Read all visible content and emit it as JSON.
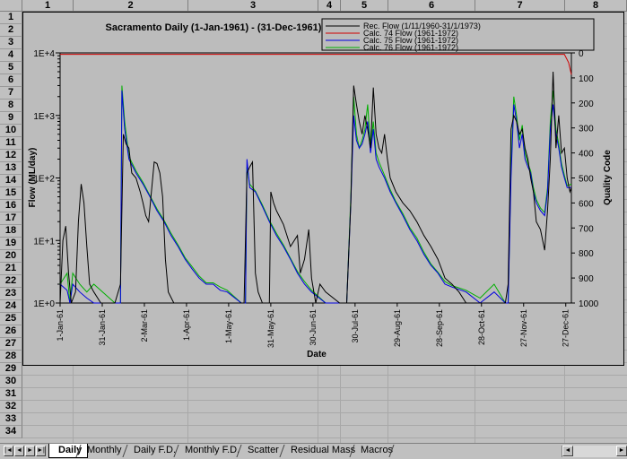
{
  "columns": [
    "1",
    "2",
    "3",
    "4",
    "5",
    "6",
    "7",
    "8"
  ],
  "rows": [
    "1",
    "2",
    "3",
    "4",
    "5",
    "6",
    "7",
    "8",
    "9",
    "10",
    "11",
    "12",
    "13",
    "14",
    "15",
    "16",
    "17",
    "18",
    "19",
    "20",
    "21",
    "22",
    "23",
    "24",
    "25",
    "26",
    "27",
    "28",
    "29",
    "30",
    "31",
    "32",
    "33",
    "34"
  ],
  "tabs": [
    {
      "label": "Daily",
      "active": true
    },
    {
      "label": "Monthly",
      "active": false
    },
    {
      "label": "Daily F.D.",
      "active": false
    },
    {
      "label": "Monthly F.D.",
      "active": false
    },
    {
      "label": "Scatter",
      "active": false
    },
    {
      "label": "Residual Mass",
      "active": false
    },
    {
      "label": "Macros",
      "active": false
    }
  ],
  "nav_icons": [
    "first-sheet-icon",
    "prev-sheet-icon",
    "next-sheet-icon",
    "last-sheet-icon"
  ],
  "colors": {
    "rec": "#000000",
    "c74": "#d00000",
    "c75": "#0000e0",
    "c76": "#00b000",
    "magenta": "#e000e0"
  },
  "chart_data": {
    "type": "line",
    "title": "Sacramento Daily (1-Jan-1961) - (31-Dec-1961)",
    "xlabel": "Date",
    "ylabel": "Flow (ML/day)",
    "y2label": "Quality Code",
    "yscale": "log",
    "ylim": [
      1,
      10000
    ],
    "y_ticks": [
      "1E+0",
      "1E+1",
      "1E+2",
      "1E+3",
      "1E+4"
    ],
    "y2lim": [
      0,
      1000
    ],
    "y2_inverted": true,
    "y2_ticks": [
      "0",
      "100",
      "200",
      "300",
      "400",
      "500",
      "600",
      "700",
      "800",
      "900",
      "1000"
    ],
    "x_ticks": [
      "1-Jan-61",
      "31-Jan-61",
      "2-Mar-61",
      "1-Apr-61",
      "1-May-61",
      "31-May-61",
      "30-Jun-61",
      "30-Jul-61",
      "29-Aug-61",
      "28-Sep-61",
      "28-Oct-61",
      "27-Nov-61",
      "27-Dec-61"
    ],
    "legend_position": "top-right",
    "series": [
      {
        "name": "Rec. Flow (1/11/1960-31/1/1973)",
        "color": "#000000",
        "points": [
          [
            1,
            1
          ],
          [
            3,
            10
          ],
          [
            5,
            17
          ],
          [
            7,
            3
          ],
          [
            9,
            1
          ],
          [
            12,
            1.5
          ],
          [
            14,
            20
          ],
          [
            16,
            80
          ],
          [
            18,
            40
          ],
          [
            20,
            8
          ],
          [
            22,
            2
          ],
          [
            25,
            1.5
          ],
          [
            30,
            1
          ],
          [
            35,
            1
          ],
          [
            40,
            1
          ],
          [
            44,
            2
          ],
          [
            46,
            500
          ],
          [
            48,
            350
          ],
          [
            50,
            300
          ],
          [
            52,
            120
          ],
          [
            55,
            100
          ],
          [
            58,
            60
          ],
          [
            60,
            40
          ],
          [
            62,
            25
          ],
          [
            64,
            20
          ],
          [
            66,
            60
          ],
          [
            68,
            180
          ],
          [
            70,
            170
          ],
          [
            72,
            120
          ],
          [
            74,
            50
          ],
          [
            76,
            5
          ],
          [
            78,
            1.5
          ],
          [
            82,
            1
          ],
          [
            90,
            1
          ],
          [
            100,
            1
          ],
          [
            110,
            1
          ],
          [
            120,
            1
          ],
          [
            125,
            1
          ],
          [
            130,
            1
          ],
          [
            132,
            1
          ],
          [
            134,
            120
          ],
          [
            136,
            150
          ],
          [
            138,
            180
          ],
          [
            140,
            3
          ],
          [
            142,
            1.5
          ],
          [
            145,
            1
          ],
          [
            150,
            1
          ],
          [
            151,
            60
          ],
          [
            153,
            40
          ],
          [
            155,
            30
          ],
          [
            160,
            18
          ],
          [
            165,
            8
          ],
          [
            170,
            12
          ],
          [
            172,
            3
          ],
          [
            175,
            5
          ],
          [
            178,
            15
          ],
          [
            180,
            2.5
          ],
          [
            183,
            1
          ],
          [
            186,
            2
          ],
          [
            190,
            1.5
          ],
          [
            200,
            1
          ],
          [
            205,
            1
          ],
          [
            208,
            40
          ],
          [
            210,
            3000
          ],
          [
            212,
            1500
          ],
          [
            214,
            800
          ],
          [
            216,
            500
          ],
          [
            218,
            1000
          ],
          [
            220,
            600
          ],
          [
            222,
            300
          ],
          [
            224,
            2800
          ],
          [
            226,
            500
          ],
          [
            228,
            300
          ],
          [
            230,
            250
          ],
          [
            232,
            500
          ],
          [
            234,
            200
          ],
          [
            236,
            100
          ],
          [
            240,
            60
          ],
          [
            245,
            40
          ],
          [
            250,
            30
          ],
          [
            255,
            20
          ],
          [
            260,
            12
          ],
          [
            265,
            8
          ],
          [
            270,
            5
          ],
          [
            275,
            2.5
          ],
          [
            280,
            2
          ],
          [
            285,
            1.5
          ],
          [
            290,
            1
          ],
          [
            300,
            1
          ],
          [
            310,
            1
          ],
          [
            315,
            1
          ],
          [
            318,
            1
          ],
          [
            320,
            2
          ],
          [
            322,
            600
          ],
          [
            324,
            1000
          ],
          [
            326,
            800
          ],
          [
            328,
            500
          ],
          [
            330,
            600
          ],
          [
            332,
            300
          ],
          [
            334,
            200
          ],
          [
            336,
            100
          ],
          [
            338,
            60
          ],
          [
            340,
            20
          ],
          [
            343,
            15
          ],
          [
            346,
            7
          ],
          [
            348,
            30
          ],
          [
            350,
            200
          ],
          [
            352,
            5000
          ],
          [
            354,
            300
          ],
          [
            356,
            1000
          ],
          [
            358,
            250
          ],
          [
            360,
            300
          ],
          [
            362,
            100
          ],
          [
            364,
            60
          ],
          [
            365,
            70
          ]
        ]
      },
      {
        "name": "Calc. 74 Flow (1961-1972)",
        "color": "#d00000",
        "points": [
          [
            1,
            9500
          ],
          [
            360,
            9500
          ],
          [
            363,
            7000
          ],
          [
            365,
            4500
          ]
        ]
      },
      {
        "name": "Calc. 75 Flow (1961-1972)",
        "color": "#0000e0",
        "points": [
          [
            1,
            2
          ],
          [
            6,
            1.6
          ],
          [
            8,
            1
          ],
          [
            10,
            2
          ],
          [
            15,
            1.5
          ],
          [
            20,
            1.2
          ],
          [
            25,
            1
          ],
          [
            40,
            1
          ],
          [
            44,
            1
          ],
          [
            45,
            2500
          ],
          [
            47,
            600
          ],
          [
            50,
            200
          ],
          [
            55,
            120
          ],
          [
            60,
            80
          ],
          [
            65,
            50
          ],
          [
            70,
            30
          ],
          [
            75,
            20
          ],
          [
            80,
            12
          ],
          [
            85,
            8
          ],
          [
            90,
            5
          ],
          [
            95,
            3.5
          ],
          [
            100,
            2.5
          ],
          [
            105,
            2
          ],
          [
            110,
            2
          ],
          [
            115,
            1.6
          ],
          [
            120,
            1.5
          ],
          [
            130,
            1
          ],
          [
            133,
            1
          ],
          [
            134,
            200
          ],
          [
            136,
            70
          ],
          [
            140,
            60
          ],
          [
            145,
            35
          ],
          [
            150,
            20
          ],
          [
            155,
            12
          ],
          [
            160,
            8
          ],
          [
            165,
            5
          ],
          [
            170,
            3
          ],
          [
            175,
            2
          ],
          [
            180,
            1.5
          ],
          [
            190,
            1
          ],
          [
            205,
            1
          ],
          [
            208,
            40
          ],
          [
            210,
            1000
          ],
          [
            212,
            400
          ],
          [
            214,
            300
          ],
          [
            216,
            350
          ],
          [
            218,
            500
          ],
          [
            220,
            800
          ],
          [
            222,
            250
          ],
          [
            224,
            600
          ],
          [
            226,
            200
          ],
          [
            228,
            150
          ],
          [
            232,
            100
          ],
          [
            236,
            60
          ],
          [
            240,
            40
          ],
          [
            245,
            25
          ],
          [
            250,
            15
          ],
          [
            255,
            10
          ],
          [
            260,
            6
          ],
          [
            265,
            4
          ],
          [
            270,
            3
          ],
          [
            275,
            2
          ],
          [
            280,
            1.8
          ],
          [
            290,
            1.5
          ],
          [
            300,
            1
          ],
          [
            310,
            1.5
          ],
          [
            318,
            1
          ],
          [
            320,
            1
          ],
          [
            322,
            100
          ],
          [
            324,
            1500
          ],
          [
            326,
            800
          ],
          [
            328,
            300
          ],
          [
            330,
            500
          ],
          [
            332,
            200
          ],
          [
            334,
            150
          ],
          [
            336,
            120
          ],
          [
            338,
            60
          ],
          [
            340,
            40
          ],
          [
            343,
            30
          ],
          [
            346,
            25
          ],
          [
            348,
            60
          ],
          [
            350,
            600
          ],
          [
            352,
            1500
          ],
          [
            354,
            500
          ],
          [
            356,
            300
          ],
          [
            358,
            150
          ],
          [
            360,
            100
          ],
          [
            362,
            70
          ],
          [
            365,
            70
          ]
        ]
      },
      {
        "name": "Calc. 76 Flow (1961-1972)",
        "color": "#00b000",
        "points": [
          [
            1,
            2
          ],
          [
            6,
            3
          ],
          [
            8,
            1
          ],
          [
            10,
            3
          ],
          [
            15,
            2
          ],
          [
            20,
            1.5
          ],
          [
            25,
            2
          ],
          [
            40,
            1
          ],
          [
            44,
            1
          ],
          [
            45,
            3000
          ],
          [
            47,
            800
          ],
          [
            50,
            220
          ],
          [
            55,
            130
          ],
          [
            60,
            85
          ],
          [
            65,
            52
          ],
          [
            70,
            32
          ],
          [
            75,
            21
          ],
          [
            80,
            13
          ],
          [
            85,
            8.5
          ],
          [
            90,
            5.3
          ],
          [
            95,
            3.8
          ],
          [
            100,
            2.7
          ],
          [
            105,
            2.1
          ],
          [
            110,
            2.1
          ],
          [
            115,
            1.8
          ],
          [
            120,
            1.6
          ],
          [
            130,
            1
          ],
          [
            133,
            1
          ],
          [
            134,
            150
          ],
          [
            136,
            80
          ],
          [
            140,
            62
          ],
          [
            145,
            37
          ],
          [
            150,
            21
          ],
          [
            155,
            13
          ],
          [
            160,
            8.5
          ],
          [
            165,
            5.2
          ],
          [
            170,
            3.2
          ],
          [
            175,
            2.2
          ],
          [
            180,
            1.6
          ],
          [
            190,
            1
          ],
          [
            205,
            1
          ],
          [
            208,
            50
          ],
          [
            210,
            2000
          ],
          [
            212,
            500
          ],
          [
            214,
            300
          ],
          [
            216,
            400
          ],
          [
            218,
            600
          ],
          [
            220,
            1500
          ],
          [
            222,
            300
          ],
          [
            224,
            800
          ],
          [
            226,
            250
          ],
          [
            228,
            180
          ],
          [
            232,
            110
          ],
          [
            236,
            65
          ],
          [
            240,
            42
          ],
          [
            245,
            27
          ],
          [
            250,
            16
          ],
          [
            255,
            11
          ],
          [
            260,
            6.5
          ],
          [
            265,
            4.2
          ],
          [
            270,
            3.1
          ],
          [
            275,
            2.2
          ],
          [
            280,
            1.9
          ],
          [
            290,
            1.6
          ],
          [
            300,
            1.2
          ],
          [
            310,
            2
          ],
          [
            318,
            1
          ],
          [
            320,
            1
          ],
          [
            322,
            150
          ],
          [
            324,
            2000
          ],
          [
            326,
            1000
          ],
          [
            328,
            400
          ],
          [
            330,
            700
          ],
          [
            332,
            250
          ],
          [
            334,
            170
          ],
          [
            336,
            130
          ],
          [
            338,
            70
          ],
          [
            340,
            45
          ],
          [
            343,
            33
          ],
          [
            346,
            28
          ],
          [
            348,
            70
          ],
          [
            350,
            800
          ],
          [
            352,
            2500
          ],
          [
            354,
            600
          ],
          [
            356,
            350
          ],
          [
            358,
            170
          ],
          [
            360,
            110
          ],
          [
            362,
            75
          ],
          [
            365,
            80
          ]
        ]
      }
    ]
  }
}
